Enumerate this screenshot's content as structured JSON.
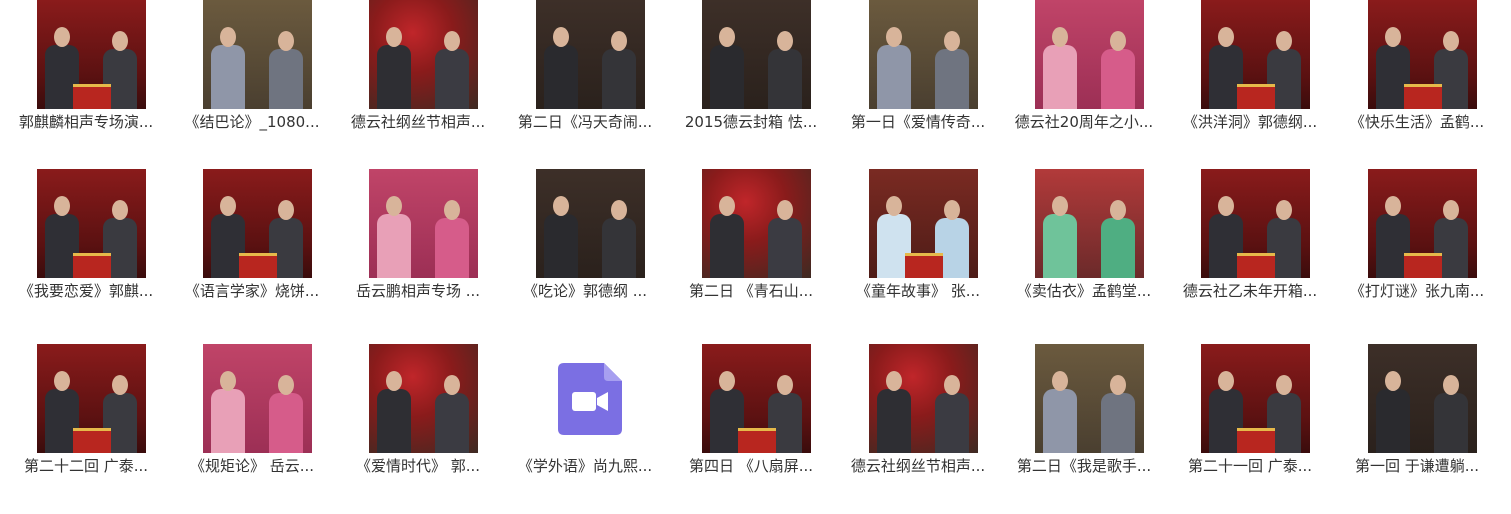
{
  "files": [
    {
      "name": "郭麒麟相声专场演...",
      "icon": "video-thumbnail",
      "theme": "stage-red"
    },
    {
      "name": "《结巴论》_1080...",
      "icon": "video-thumbnail",
      "theme": "gray-stage"
    },
    {
      "name": "德云社纲丝节相声...",
      "icon": "video-thumbnail",
      "theme": "red-flowers"
    },
    {
      "name": "第二日《冯天奇闹...",
      "icon": "video-thumbnail",
      "theme": "dark-room"
    },
    {
      "name": "2015德云封箱 怯...",
      "icon": "video-thumbnail",
      "theme": "dark-room"
    },
    {
      "name": "第一日《爱情传奇...",
      "icon": "video-thumbnail",
      "theme": "gray-stage"
    },
    {
      "name": "德云社20周年之小...",
      "icon": "video-thumbnail",
      "theme": "pink-robes"
    },
    {
      "name": "《洪洋洞》郭德纲...",
      "icon": "video-thumbnail",
      "theme": "stage-red"
    },
    {
      "name": "《快乐生活》孟鹤...",
      "icon": "video-thumbnail",
      "theme": "stage-red"
    },
    {
      "name": "《我要恋爱》郭麒...",
      "icon": "video-thumbnail",
      "theme": "stage-red"
    },
    {
      "name": "《语言学家》烧饼...",
      "icon": "video-thumbnail",
      "theme": "stage-red"
    },
    {
      "name": "岳云鹏相声专场 ...",
      "icon": "video-thumbnail",
      "theme": "pink-robes"
    },
    {
      "name": "《吃论》郭德纲 ...",
      "icon": "video-thumbnail",
      "theme": "dark-room"
    },
    {
      "name": "第二日 《青石山...",
      "icon": "video-thumbnail",
      "theme": "red-flowers"
    },
    {
      "name": "《童年故事》 张...",
      "icon": "video-thumbnail",
      "theme": "white-robes"
    },
    {
      "name": "《卖估衣》孟鹤堂...",
      "icon": "video-thumbnail",
      "theme": "green-robes"
    },
    {
      "name": "德云社乙未年开箱...",
      "icon": "video-thumbnail",
      "theme": "stage-red"
    },
    {
      "name": "《打灯谜》张九南...",
      "icon": "video-thumbnail",
      "theme": "stage-red"
    },
    {
      "name": "第二十二回 广泰...",
      "icon": "video-thumbnail",
      "theme": "stage-red"
    },
    {
      "name": "《规矩论》 岳云...",
      "icon": "video-thumbnail",
      "theme": "pink-robes"
    },
    {
      "name": "《爱情时代》 郭...",
      "icon": "video-thumbnail",
      "theme": "red-flowers"
    },
    {
      "name": "《学外语》尚九熙...",
      "icon": "video-file-icon",
      "theme": "none"
    },
    {
      "name": "第四日 《八扇屏...",
      "icon": "video-thumbnail",
      "theme": "stage-red"
    },
    {
      "name": "德云社纲丝节相声...",
      "icon": "video-thumbnail",
      "theme": "red-flowers"
    },
    {
      "name": "第二日《我是歌手...",
      "icon": "video-thumbnail",
      "theme": "gray-stage"
    },
    {
      "name": "第二十一回 广泰...",
      "icon": "video-thumbnail",
      "theme": "stage-red"
    },
    {
      "name": "第一回 于谦遭躺...",
      "icon": "video-thumbnail",
      "theme": "dark-room"
    }
  ],
  "colors": {
    "label_text": "#333333",
    "video_icon": "#7b6fe3",
    "background": "#ffffff"
  }
}
